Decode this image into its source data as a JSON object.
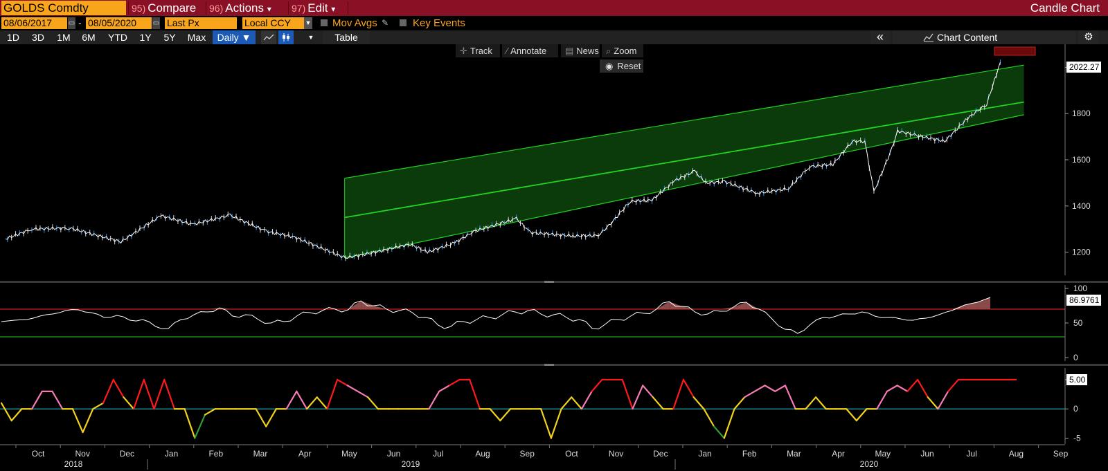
{
  "titlebar": {
    "ticker": "GOLDS Comdty",
    "compare_num": "95)",
    "compare_label": "Compare",
    "actions_num": "96)",
    "actions_label": "Actions",
    "edit_num": "97)",
    "edit_label": "Edit",
    "dropdown_glyph": "▾",
    "chart_title": "Candle Chart"
  },
  "settings": {
    "start_date": "08/06/2017",
    "date_separator": "-",
    "end_date": "08/05/2020",
    "price_field": "Last Px",
    "currency": "Local CCY",
    "mov_avgs_label": "Mov Avgs",
    "key_events_label": "Key Events"
  },
  "toolbar": {
    "periods": [
      "1D",
      "3D",
      "1M",
      "6M",
      "YTD",
      "1Y",
      "5Y",
      "Max"
    ],
    "frequency": "Daily ▼",
    "table_label": "Table",
    "collapse_glyph": "«",
    "chart_content_label": "Chart Content",
    "settings_glyph": "⚙"
  },
  "overlay": {
    "track_label": "Track",
    "annotate_label": "Annotate",
    "news_label": "News",
    "zoom_label": "Zoom",
    "reset_label": "Reset"
  },
  "colors": {
    "title_bar": "#8a1025",
    "field_orange": "#f9a51b",
    "channel_fill": "#0b3a0b",
    "channel_line": "#22d422",
    "price_series": "#ffffff",
    "candle_blue": "#2f8fe6",
    "rsi_upper": "#d21a1a",
    "rsi_lower": "#22a022",
    "indicator_zero": "#2aa8b3",
    "heat_red": "#ff1a1a",
    "heat_pink": "#f67ab4",
    "heat_yellow": "#f2d21a",
    "heat_green": "#2e9e35"
  },
  "chart_data": [
    {
      "type": "line",
      "series": [
        {
          "values": [
            [
              "2017-08-07",
              1257
            ],
            [
              "2017-09-05",
              1300
            ],
            [
              "2017-10-16",
              1305
            ],
            [
              "2017-12-12",
              1245
            ],
            [
              "2018-01-25",
              1358
            ],
            [
              "2018-03-01",
              1320
            ],
            [
              "2018-04-11",
              1360
            ],
            [
              "2018-05-21",
              1290
            ],
            [
              "2018-06-21",
              1265
            ],
            [
              "2018-08-16",
              1175
            ],
            [
              "2018-09-18",
              1200
            ],
            [
              "2018-10-26",
              1235
            ],
            [
              "2018-11-14",
              1200
            ],
            [
              "2018-12-14",
              1240
            ],
            [
              "2019-01-04",
              1290
            ],
            [
              "2019-02-20",
              1345
            ],
            [
              "2019-03-07",
              1285
            ],
            [
              "2019-04-23",
              1270
            ],
            [
              "2019-05-21",
              1272
            ],
            [
              "2019-06-04",
              1325
            ],
            [
              "2019-06-25",
              1420
            ],
            [
              "2019-07-19",
              1425
            ],
            [
              "2019-08-13",
              1510
            ],
            [
              "2019-09-04",
              1550
            ],
            [
              "2019-09-16",
              1500
            ],
            [
              "2019-10-07",
              1505
            ],
            [
              "2019-11-12",
              1455
            ],
            [
              "2019-12-16",
              1475
            ],
            [
              "2020-01-08",
              1570
            ],
            [
              "2020-02-03",
              1580
            ],
            [
              "2020-02-24",
              1680
            ],
            [
              "2020-03-09",
              1680
            ],
            [
              "2020-03-19",
              1460
            ],
            [
              "2020-04-08",
              1650
            ],
            [
              "2020-04-14",
              1725
            ],
            [
              "2020-05-05",
              1705
            ],
            [
              "2020-06-05",
              1680
            ],
            [
              "2020-06-30",
              1780
            ],
            [
              "2020-07-21",
              1840
            ],
            [
              "2020-08-05",
              2022.27
            ]
          ]
        }
      ],
      "channel": [
        {
          "x": "2019-02-04",
          "y": 1520
        },
        {
          "x": "2020-08-31",
          "y": 2010
        }
      ],
      "channel_center_line_y": [
        1350,
        1850
      ],
      "channel_lower_line_y": [
        1175,
        1795
      ],
      "ylim": [
        1100,
        2100
      ],
      "yticks": [
        1200,
        1400,
        1600,
        1800,
        2000
      ],
      "last_value_label": "2022.27",
      "grid": false
    },
    {
      "type": "line",
      "values": [
        52,
        54,
        55,
        60,
        63,
        68,
        69,
        65,
        58,
        61,
        54,
        55,
        45,
        42,
        55,
        62,
        66,
        72,
        60,
        62,
        55,
        50,
        52,
        60,
        65,
        68,
        70,
        69,
        82,
        75,
        70,
        68,
        65,
        58,
        47,
        45,
        52,
        55,
        58,
        62,
        66,
        68,
        63,
        62,
        58,
        55,
        42,
        48,
        55,
        60,
        64,
        70,
        81,
        74,
        66,
        63,
        67,
        73,
        80,
        70,
        56,
        41,
        35,
        48,
        58,
        60,
        63,
        66,
        60,
        58,
        56,
        54,
        57,
        62,
        68,
        76,
        80,
        87
      ],
      "upper_line": 70,
      "lower_line": 30,
      "ylim": [
        -5,
        105
      ],
      "yticks": [
        0,
        50,
        100
      ],
      "last_value_label": "86.9761",
      "grid": false
    },
    {
      "type": "line",
      "values": [
        1,
        -2,
        0,
        0,
        3,
        3,
        0,
        0,
        -4,
        0,
        1,
        5,
        2,
        0,
        5,
        0,
        5,
        0,
        0,
        -5,
        -1,
        0,
        0,
        0,
        0,
        0,
        -3,
        0,
        0,
        3,
        0,
        2,
        0,
        5,
        4,
        3,
        2,
        0,
        0,
        0,
        0,
        0,
        0,
        3,
        4,
        5,
        5,
        0,
        0,
        -2,
        0,
        0,
        0,
        0,
        -5,
        0,
        2,
        0,
        3,
        5,
        5,
        5,
        0,
        4,
        2,
        0,
        0,
        5,
        2,
        0,
        -3,
        -5,
        0,
        2,
        3,
        4,
        3,
        4,
        0,
        0,
        2,
        0,
        0,
        0,
        -2,
        0,
        0,
        3,
        4,
        3,
        5,
        2,
        0,
        3,
        5,
        5,
        5,
        5
      ],
      "zero_line": 0,
      "ylim": [
        -6,
        7
      ],
      "yticks": [
        -5,
        0,
        5
      ],
      "last_value_label": "5.00",
      "grid": false
    }
  ],
  "x_axis": {
    "months": [
      "Oct",
      "Nov",
      "Dec",
      "Jan",
      "Feb",
      "Mar",
      "Apr",
      "May",
      "Jun",
      "Jul",
      "Aug",
      "Sep",
      "Oct",
      "Nov",
      "Dec",
      "Jan",
      "Feb",
      "Mar",
      "Apr",
      "May",
      "Jun",
      "Jul",
      "Aug",
      "Sep"
    ],
    "years": [
      "2018",
      "2019",
      "2020"
    ]
  }
}
